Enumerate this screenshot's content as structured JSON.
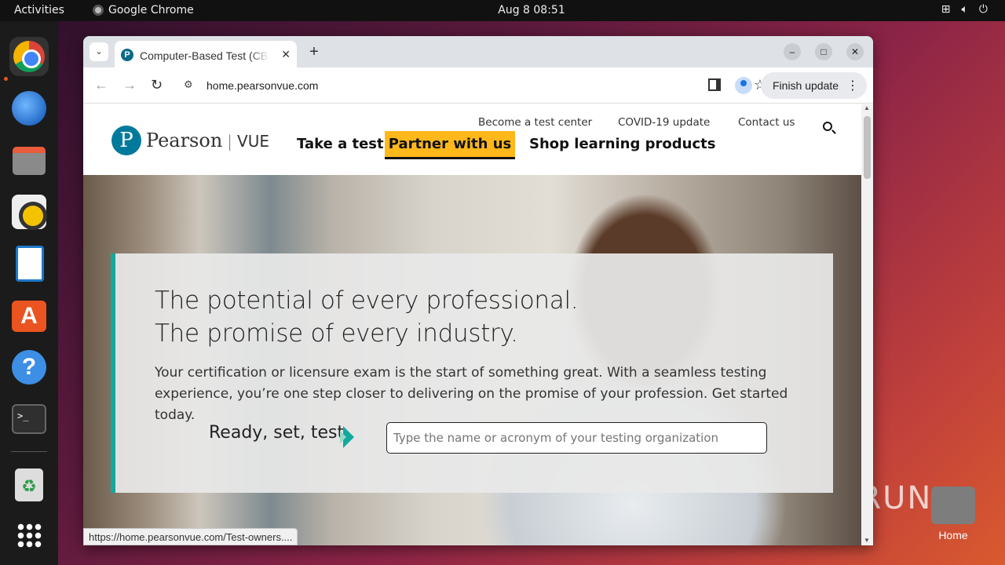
{
  "topbar": {
    "activities": "Activities",
    "app_name": "Google Chrome",
    "clock": "Aug 8  08:51",
    "tray_icons": [
      "network-icon",
      "volume-icon",
      "power-icon"
    ]
  },
  "dock": {
    "items": [
      "chrome",
      "thunderbird",
      "files",
      "rhythmbox",
      "libreoffice-writer",
      "app-center",
      "help",
      "terminal",
      "trash",
      "show-apps"
    ]
  },
  "desktop": {
    "home_label": "Home",
    "watermark": "ANY.RUN"
  },
  "browser": {
    "tab_title": "Computer-Based Test (CBT)",
    "tab_favicon": "P",
    "url": "home.pearsonvue.com",
    "finish_update": "Finish update",
    "status_url": "https://home.pearsonvue.com/Test-owners...."
  },
  "site": {
    "logo_brand": "Pearson",
    "logo_product": "VUE",
    "utility_nav": [
      "Become a test center",
      "COVID-19 update",
      "Contact us"
    ],
    "main_nav": [
      "Take a test",
      "Partner with us",
      "Shop learning products"
    ],
    "hero": {
      "headline_1": "The potential of every professional.",
      "headline_2": "The promise of every industry.",
      "body": "Your certification or licensure exam is the start of something great. With a seamless testing experience, you’re one step closer to delivering on the promise of your profession. Get started today.",
      "cta_label": "Ready, set, test",
      "search_placeholder": "Type the name or acronym of your testing organization"
    },
    "colors": {
      "accent_yellow": "#ffb81c",
      "accent_teal": "#12a89d",
      "brand_blue": "#007a9c"
    }
  }
}
